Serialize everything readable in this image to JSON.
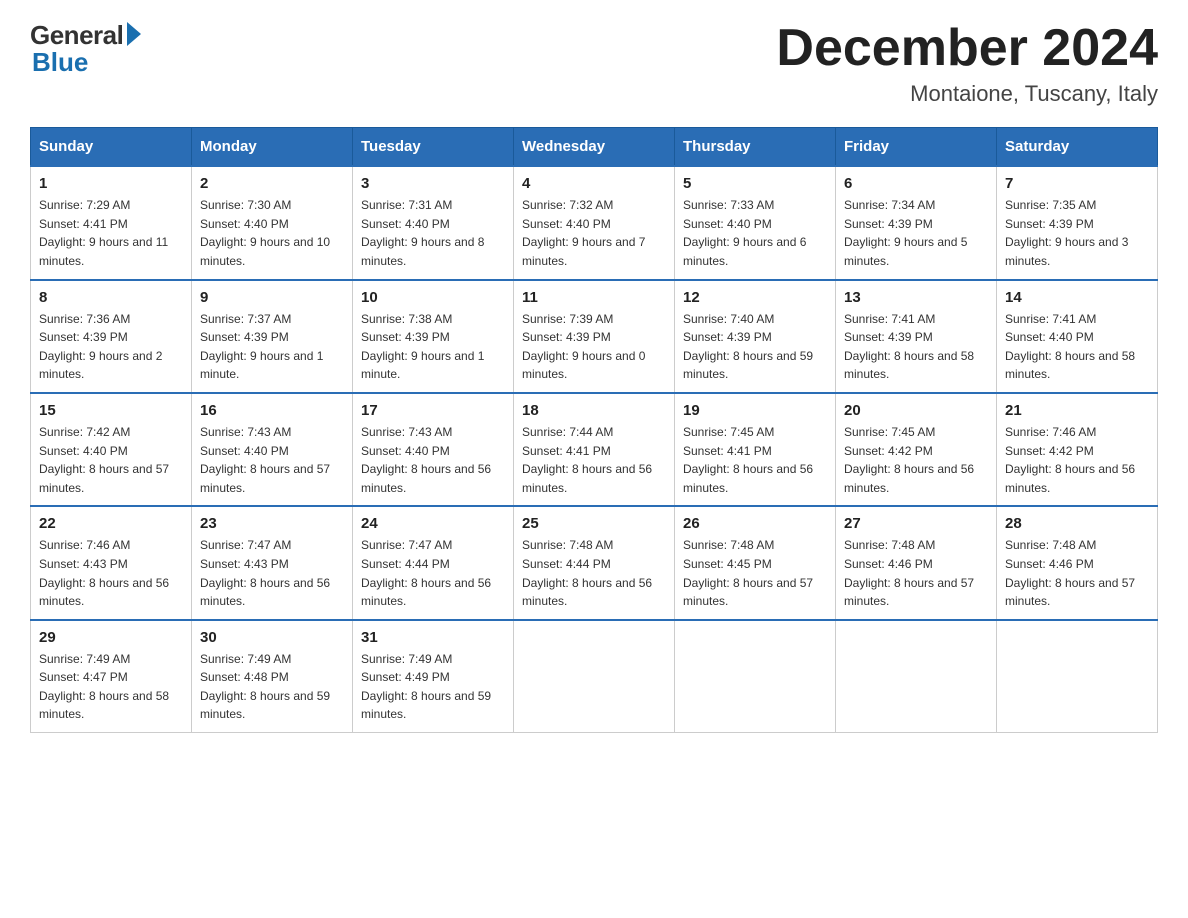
{
  "header": {
    "logo_general": "General",
    "logo_blue": "Blue",
    "month_title": "December 2024",
    "location": "Montaione, Tuscany, Italy"
  },
  "weekdays": [
    "Sunday",
    "Monday",
    "Tuesday",
    "Wednesday",
    "Thursday",
    "Friday",
    "Saturday"
  ],
  "weeks": [
    [
      {
        "day": "1",
        "sunrise": "7:29 AM",
        "sunset": "4:41 PM",
        "daylight": "9 hours and 11 minutes."
      },
      {
        "day": "2",
        "sunrise": "7:30 AM",
        "sunset": "4:40 PM",
        "daylight": "9 hours and 10 minutes."
      },
      {
        "day": "3",
        "sunrise": "7:31 AM",
        "sunset": "4:40 PM",
        "daylight": "9 hours and 8 minutes."
      },
      {
        "day": "4",
        "sunrise": "7:32 AM",
        "sunset": "4:40 PM",
        "daylight": "9 hours and 7 minutes."
      },
      {
        "day": "5",
        "sunrise": "7:33 AM",
        "sunset": "4:40 PM",
        "daylight": "9 hours and 6 minutes."
      },
      {
        "day": "6",
        "sunrise": "7:34 AM",
        "sunset": "4:39 PM",
        "daylight": "9 hours and 5 minutes."
      },
      {
        "day": "7",
        "sunrise": "7:35 AM",
        "sunset": "4:39 PM",
        "daylight": "9 hours and 3 minutes."
      }
    ],
    [
      {
        "day": "8",
        "sunrise": "7:36 AM",
        "sunset": "4:39 PM",
        "daylight": "9 hours and 2 minutes."
      },
      {
        "day": "9",
        "sunrise": "7:37 AM",
        "sunset": "4:39 PM",
        "daylight": "9 hours and 1 minute."
      },
      {
        "day": "10",
        "sunrise": "7:38 AM",
        "sunset": "4:39 PM",
        "daylight": "9 hours and 1 minute."
      },
      {
        "day": "11",
        "sunrise": "7:39 AM",
        "sunset": "4:39 PM",
        "daylight": "9 hours and 0 minutes."
      },
      {
        "day": "12",
        "sunrise": "7:40 AM",
        "sunset": "4:39 PM",
        "daylight": "8 hours and 59 minutes."
      },
      {
        "day": "13",
        "sunrise": "7:41 AM",
        "sunset": "4:39 PM",
        "daylight": "8 hours and 58 minutes."
      },
      {
        "day": "14",
        "sunrise": "7:41 AM",
        "sunset": "4:40 PM",
        "daylight": "8 hours and 58 minutes."
      }
    ],
    [
      {
        "day": "15",
        "sunrise": "7:42 AM",
        "sunset": "4:40 PM",
        "daylight": "8 hours and 57 minutes."
      },
      {
        "day": "16",
        "sunrise": "7:43 AM",
        "sunset": "4:40 PM",
        "daylight": "8 hours and 57 minutes."
      },
      {
        "day": "17",
        "sunrise": "7:43 AM",
        "sunset": "4:40 PM",
        "daylight": "8 hours and 56 minutes."
      },
      {
        "day": "18",
        "sunrise": "7:44 AM",
        "sunset": "4:41 PM",
        "daylight": "8 hours and 56 minutes."
      },
      {
        "day": "19",
        "sunrise": "7:45 AM",
        "sunset": "4:41 PM",
        "daylight": "8 hours and 56 minutes."
      },
      {
        "day": "20",
        "sunrise": "7:45 AM",
        "sunset": "4:42 PM",
        "daylight": "8 hours and 56 minutes."
      },
      {
        "day": "21",
        "sunrise": "7:46 AM",
        "sunset": "4:42 PM",
        "daylight": "8 hours and 56 minutes."
      }
    ],
    [
      {
        "day": "22",
        "sunrise": "7:46 AM",
        "sunset": "4:43 PM",
        "daylight": "8 hours and 56 minutes."
      },
      {
        "day": "23",
        "sunrise": "7:47 AM",
        "sunset": "4:43 PM",
        "daylight": "8 hours and 56 minutes."
      },
      {
        "day": "24",
        "sunrise": "7:47 AM",
        "sunset": "4:44 PM",
        "daylight": "8 hours and 56 minutes."
      },
      {
        "day": "25",
        "sunrise": "7:48 AM",
        "sunset": "4:44 PM",
        "daylight": "8 hours and 56 minutes."
      },
      {
        "day": "26",
        "sunrise": "7:48 AM",
        "sunset": "4:45 PM",
        "daylight": "8 hours and 57 minutes."
      },
      {
        "day": "27",
        "sunrise": "7:48 AM",
        "sunset": "4:46 PM",
        "daylight": "8 hours and 57 minutes."
      },
      {
        "day": "28",
        "sunrise": "7:48 AM",
        "sunset": "4:46 PM",
        "daylight": "8 hours and 57 minutes."
      }
    ],
    [
      {
        "day": "29",
        "sunrise": "7:49 AM",
        "sunset": "4:47 PM",
        "daylight": "8 hours and 58 minutes."
      },
      {
        "day": "30",
        "sunrise": "7:49 AM",
        "sunset": "4:48 PM",
        "daylight": "8 hours and 59 minutes."
      },
      {
        "day": "31",
        "sunrise": "7:49 AM",
        "sunset": "4:49 PM",
        "daylight": "8 hours and 59 minutes."
      },
      null,
      null,
      null,
      null
    ]
  ],
  "labels": {
    "sunrise": "Sunrise:",
    "sunset": "Sunset:",
    "daylight": "Daylight:"
  }
}
